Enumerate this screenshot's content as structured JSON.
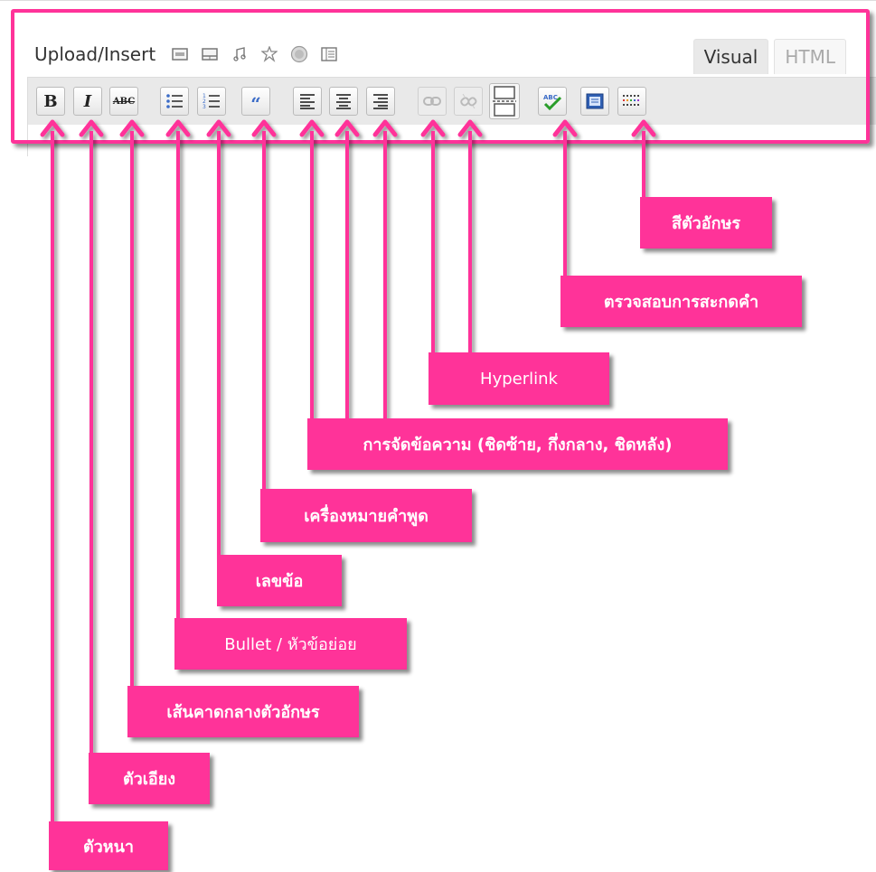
{
  "editor": {
    "upload_label": "Upload/Insert",
    "media_icons": [
      "image-icon",
      "video-icon",
      "audio-icon",
      "media-icon",
      "add-circle-icon",
      "gallery-icon"
    ],
    "tabs": [
      {
        "label": "Visual",
        "active": true
      },
      {
        "label": "HTML",
        "active": false
      }
    ],
    "toolbar": {
      "bold": "B",
      "italic": "I",
      "strikethrough": "ABC",
      "buttons": [
        "bold-button",
        "italic-button",
        "strikethrough-button",
        "bullet-list-button",
        "numbered-list-button",
        "blockquote-button",
        "align-left-button",
        "align-center-button",
        "align-right-button",
        "insert-link-button",
        "unlink-button",
        "insert-more-button",
        "spellcheck-button",
        "fullscreen-button",
        "kitchen-sink-button"
      ]
    }
  },
  "callouts": {
    "bold": "ตัวหนา",
    "italic": "ตัวเอียง",
    "strikethrough": "เส้นคาดกลางตัวอักษร",
    "bullet": "Bullet / หัวข้อย่อย",
    "numbered": "เลขข้อ",
    "quote": "เครื่องหมายคำพูด",
    "align": "การจัดข้อความ (ชิดซ้าย, กึ่งกลาง, ชิดหลัง)",
    "hyperlink": "Hyperlink",
    "spellcheck": "ตรวจสอบการสะกดคำ",
    "textcolor": "สีตัวอักษร"
  },
  "colors": {
    "accent": "#ff3399",
    "toolbar_bg": "#e9e9e9",
    "spellcheck_green": "#2a9d2a",
    "link_gray": "#b8b8b8"
  }
}
